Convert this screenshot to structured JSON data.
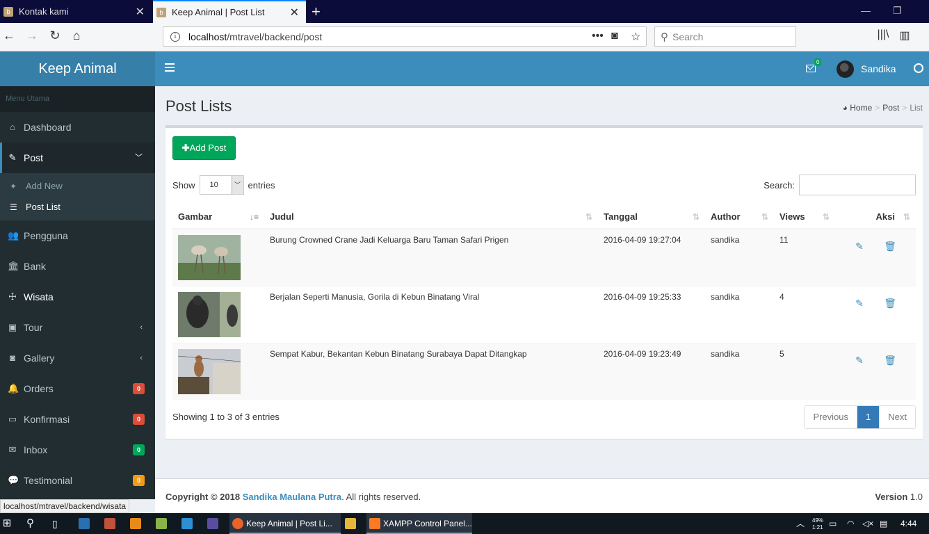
{
  "browser": {
    "tabs": [
      {
        "title": "Kontak kami",
        "active": false
      },
      {
        "title": "Keep Animal | Post List",
        "active": true
      }
    ],
    "url_prefix": "localhost",
    "url_path": "/mtravel/backend/post",
    "search_placeholder": "Search",
    "status_url": "localhost/mtravel/backend/wisata"
  },
  "app": {
    "logo": "Keep Animal",
    "user_name": "Sandika",
    "mail_count": "0"
  },
  "sidebar": {
    "header": "Menu Utama",
    "items": [
      {
        "label": "Dashboard",
        "icon": "home-icon"
      },
      {
        "label": "Post",
        "icon": "pencil-icon"
      },
      {
        "label": "Pengguna",
        "icon": "users-icon"
      },
      {
        "label": "Bank",
        "icon": "bank-icon"
      },
      {
        "label": "Wisata",
        "icon": "signpost-icon"
      },
      {
        "label": "Tour",
        "icon": "bus-icon"
      },
      {
        "label": "Gallery",
        "icon": "camera-icon"
      },
      {
        "label": "Orders",
        "icon": "bell-icon",
        "badge": "0",
        "badge_color": "#dd4b39"
      },
      {
        "label": "Konfirmasi",
        "icon": "money-icon",
        "badge": "0",
        "badge_color": "#dd4b39"
      },
      {
        "label": "Inbox",
        "icon": "envelope-icon",
        "badge": "0",
        "badge_color": "#00a65a"
      },
      {
        "label": "Testimonial",
        "icon": "comment-icon",
        "badge": "0",
        "badge_color": "#f39c12"
      }
    ],
    "post_sub": [
      {
        "label": "Add New",
        "icon": "thumbtack-icon"
      },
      {
        "label": "Post List",
        "icon": "list-icon"
      }
    ]
  },
  "content": {
    "title": "Post Lists",
    "breadcrumb": [
      "Home",
      "Post",
      "List"
    ],
    "add_button": "Add Post",
    "show_label": "Show",
    "length_value": "10",
    "entries_label": "entries",
    "search_label": "Search:",
    "columns": [
      "Gambar",
      "Judul",
      "Tanggal",
      "Author",
      "Views",
      "Aksi"
    ],
    "rows": [
      {
        "judul": "Burung Crowned Crane Jadi Keluarga Baru Taman Safari Prigen",
        "tanggal": "2016-04-09 19:27:04",
        "author": "sandika",
        "views": "11"
      },
      {
        "judul": "Berjalan Seperti Manusia, Gorila di Kebun Binatang Viral",
        "tanggal": "2016-04-09 19:25:33",
        "author": "sandika",
        "views": "4"
      },
      {
        "judul": "Sempat Kabur, Bekantan Kebun Binatang Surabaya Dapat Ditangkap",
        "tanggal": "2016-04-09 19:23:49",
        "author": "sandika",
        "views": "5"
      }
    ],
    "info": "Showing 1 to 3 of 3 entries",
    "pager": {
      "prev": "Previous",
      "page": "1",
      "next": "Next"
    }
  },
  "footer": {
    "copy_prefix": "Copyright © 2018",
    "author": "Sandika Maulana Putra",
    "rights": ". All rights reserved.",
    "version_label": "Version",
    "version": "1.0"
  },
  "taskbar": {
    "apps": [
      {
        "label": "Keep Animal | Post Li...",
        "icon": "firefox-icon"
      },
      {
        "label": "XAMPP Control Panel...",
        "icon": "xampp-icon"
      }
    ],
    "time": "4:44 AM",
    "temp": "49%",
    "temp2": "1:21"
  },
  "colors": {
    "primary": "#3c8dbc",
    "sidebar": "#222d32",
    "success": "#00a65a"
  }
}
